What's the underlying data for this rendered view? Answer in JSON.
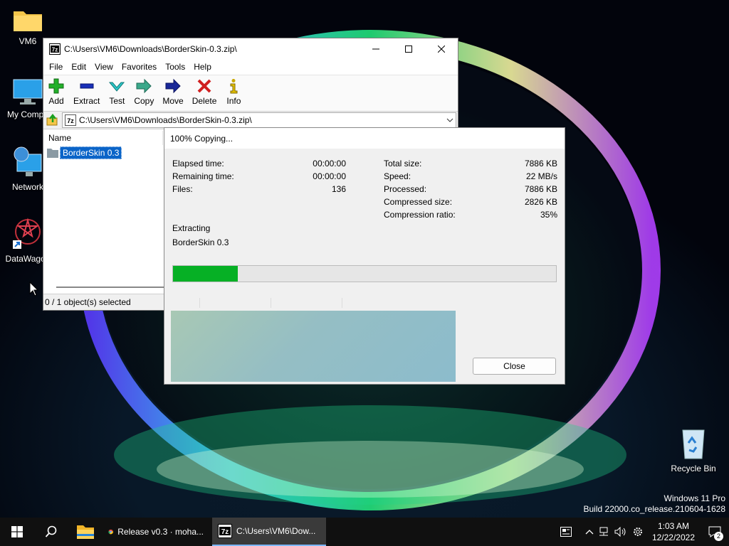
{
  "desktop": {
    "icons": [
      {
        "label": "VM6"
      },
      {
        "label": "My Compu"
      },
      {
        "label": "Network"
      },
      {
        "label": "DataWagon"
      },
      {
        "label": "Recycle Bin"
      }
    ],
    "watermark": {
      "line1": "Windows 11 Pro",
      "line2": "Build 22000.co_release.210604-1628"
    }
  },
  "zip_window": {
    "title": "C:\\Users\\VM6\\Downloads\\BorderSkin-0.3.zip\\",
    "app_badge": "7z",
    "menu": [
      "File",
      "Edit",
      "View",
      "Favorites",
      "Tools",
      "Help"
    ],
    "toolbar": [
      "Add",
      "Extract",
      "Test",
      "Copy",
      "Move",
      "Delete",
      "Info"
    ],
    "address": "C:\\Users\\VM6\\Downloads\\BorderSkin-0.3.zip\\",
    "column_name": "Name",
    "file_item": "BorderSkin 0.3",
    "status": "0 / 1 object(s) selected"
  },
  "progress_dialog": {
    "title": "100% Copying...",
    "left_stats": [
      {
        "label": "Elapsed time:",
        "value": "00:00:00"
      },
      {
        "label": "Remaining time:",
        "value": "00:00:00"
      },
      {
        "label": "Files:",
        "value": "136"
      }
    ],
    "right_stats": [
      {
        "label": "Total size:",
        "value": "7886 KB"
      },
      {
        "label": "Speed:",
        "value": "22 MB/s"
      },
      {
        "label": "Processed:",
        "value": "7886 KB"
      },
      {
        "label": "Compressed size:",
        "value": "2826 KB"
      },
      {
        "label": "Compression ratio:",
        "value": "35%"
      }
    ],
    "operation": "Extracting",
    "current_item": "BorderSkin 0.3",
    "progress_fraction": 0.17,
    "close_label": "Close"
  },
  "taskbar": {
    "apps": [
      {
        "label": "Release v0.3 · moha..."
      },
      {
        "label": "C:\\Users\\VM6\\Dow..."
      }
    ],
    "app_badge": "7z",
    "clock_time": "1:03 AM",
    "clock_date": "12/22/2022",
    "notification_count": "2"
  },
  "colors": {
    "progress_fill": "#06b025",
    "selection": "#0a64c8",
    "taskbar": "#101010"
  }
}
